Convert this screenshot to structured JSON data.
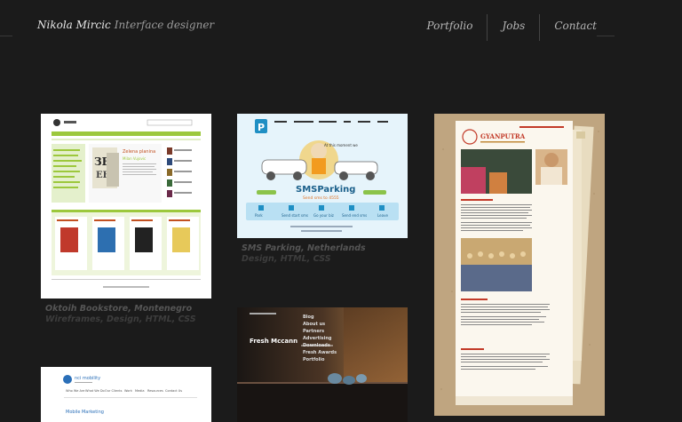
{
  "header": {
    "name": "Nikola Mircic",
    "role": "Interface designer",
    "nav": [
      "Portfolio",
      "Jobs",
      "Contact"
    ]
  },
  "projects": [
    {
      "title": "Oktoih Bookstore, Montenegro",
      "tags": "Wireframes, Design, HTML, CSS"
    },
    {
      "title": "SMS Parking, Netherlands",
      "tags": "Design, HTML, CSS"
    },
    {
      "title": "",
      "tags": ""
    },
    {
      "title": "",
      "tags": ""
    },
    {
      "title": "",
      "tags": ""
    }
  ],
  "thumbs": {
    "sms_logo": "SMSParking",
    "sms_sub": "Send sms to 4555",
    "sms_labels": [
      "Park",
      "Send start sms",
      "Go your biz",
      "Send end sms",
      "Leave"
    ],
    "gyan_logo": "GYANPUTRA",
    "fresh_title": "Fresh Mccann",
    "fresh_menu": [
      "Blog",
      "About us",
      "Partners",
      "Advertising",
      "Downloads",
      "Fresh Awards",
      "Portfolio"
    ],
    "nci_logo": "nci mobility",
    "nci_heading": "Mobile Marketing",
    "nci_menu": [
      "Who We Are",
      "What We Do",
      "Our Clients",
      "Work",
      "Media",
      "Resources",
      "Contact Us"
    ],
    "ok_hero": "Zelena planina",
    "ok_author": "Milan Vujovic"
  },
  "colors": {
    "background": "#1b1b1b",
    "ok_green": "#9cc83c",
    "sms_blue": "#1f8fc4",
    "gyan_red": "#c23a28"
  }
}
